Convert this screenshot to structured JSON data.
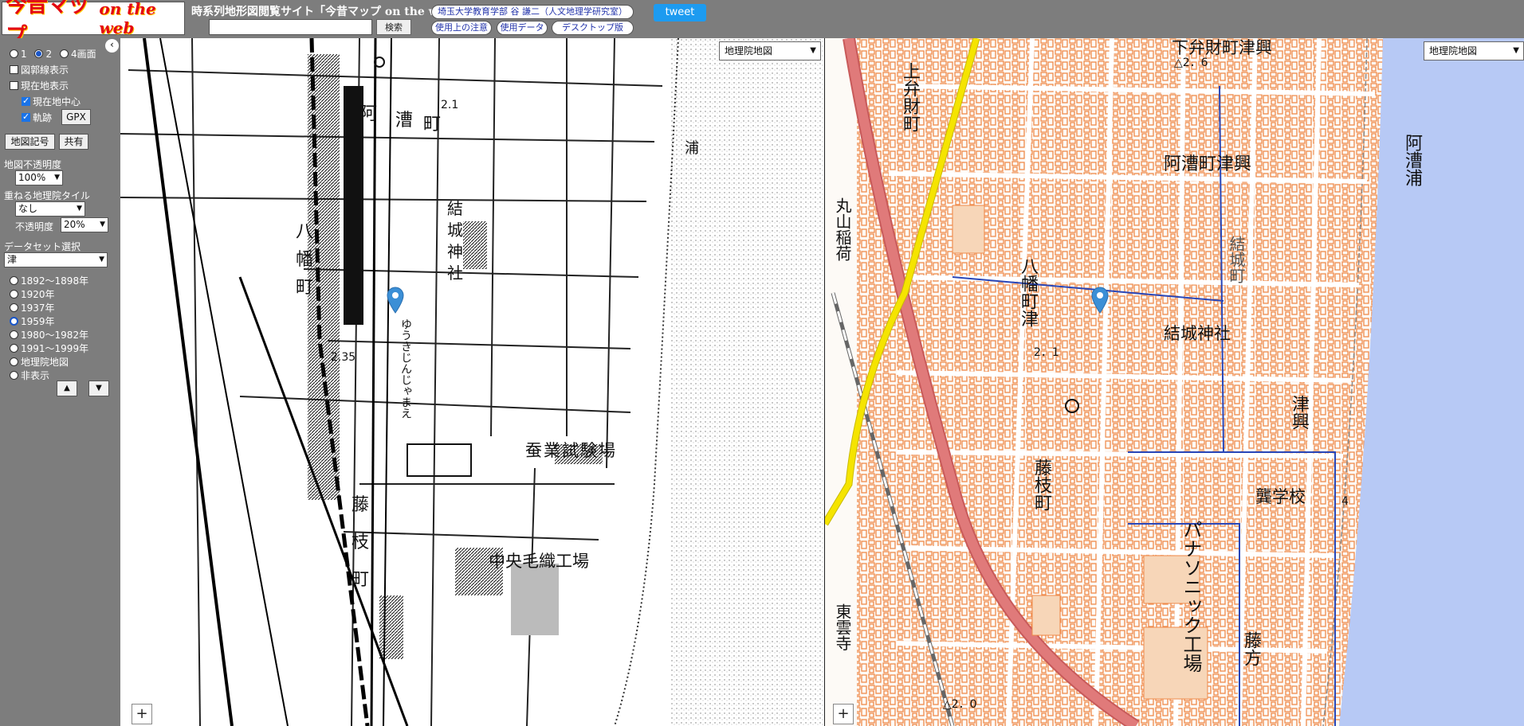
{
  "header": {
    "logo_jp": "今昔マップ",
    "logo_en": "on the web",
    "site_title": "時系列地形図閲覧サイト「今昔マップ on the web」",
    "search_placeholder": "",
    "search_label": "検索",
    "author_link": "埼玉大学教育学部 谷 謙二（人文地理学研究室）",
    "notes_link": "使用上の注意",
    "data_link": "使用データ",
    "desktop_link": "デスクトップ版",
    "tweet_label": "tweet"
  },
  "sidebar": {
    "collapse_icon": "‹",
    "screen_options": [
      "1",
      "2",
      "4画面"
    ],
    "screen_selected": "2",
    "grid_lines_label": "図郭線表示",
    "grid_lines_checked": false,
    "current_location_label": "現在地表示",
    "current_location_checked": false,
    "center_current_label": "現在地中心",
    "center_current_checked": true,
    "track_label": "軌跡",
    "track_checked": true,
    "gpx_label": "GPX",
    "map_symbols_label": "地図記号",
    "share_label": "共有",
    "map_opacity_label": "地図不透明度",
    "map_opacity_value": "100%",
    "overlay_tile_label": "重ねる地理院タイル",
    "overlay_tile_value": "なし",
    "overlay_opacity_label": "不透明度",
    "overlay_opacity_value": "20%",
    "dataset_label": "データセット選択",
    "dataset_value": "津",
    "periods": [
      "1892～1898年",
      "1920年",
      "1937年",
      "1959年",
      "1980～1982年",
      "1991～1999年",
      "地理院地図",
      "非表示"
    ],
    "period_selected": "1959年",
    "up_icon": "▲",
    "down_icon": "▼"
  },
  "left_map": {
    "layer_select": "地理院地図",
    "zoom_in": "+",
    "labels": [
      "阿",
      "漕",
      "町",
      "八",
      "幡",
      "町",
      "結",
      "城",
      "神",
      "社",
      "蚕業試験場",
      "中央毛織工場",
      "藤",
      "枝",
      "町",
      "浦",
      "ゆうきじんじゃまえ",
      "2.35",
      "2.1"
    ]
  },
  "right_map": {
    "layer_select": "地理院地図",
    "zoom_in": "+",
    "labels": [
      "上弁財町",
      "丸山稲荷",
      "八幡町津",
      "阿漕町津興",
      "結城町",
      "結城神社",
      "津興",
      "龔学校",
      "藤枝町",
      "パナソニック工場",
      "東雲寺",
      "藤方",
      "阿漕浦",
      "下弁財町津興",
      "△2．6",
      "2．1",
      "△2．0",
      "4"
    ]
  },
  "colors": {
    "chrome_gray": "#7d7d7d",
    "logo_red": "#e30613",
    "tweet_blue": "#1d9bf0",
    "pin_blue": "#3b8fd6",
    "road_red": "#e07a7a",
    "road_yellow": "#f5e400",
    "building_orange": "#f0a070",
    "sea_blue": "#b7c9f5"
  }
}
